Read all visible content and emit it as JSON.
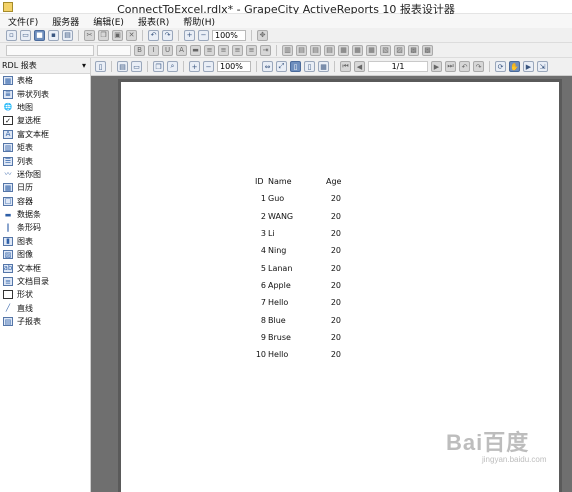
{
  "window": {
    "title": "ConnectToExcel.rdlx* - GrapeCity ActiveReports 10 报表设计器"
  },
  "menu": {
    "items": [
      "文件(F)",
      "服务器",
      "编辑(E)",
      "报表(R)",
      "帮助(H)"
    ]
  },
  "toolbar": {
    "zoom": "100%"
  },
  "viewer_toolbar": {
    "zoom": "100%",
    "page_indicator": "1/1"
  },
  "sidebar": {
    "header": "RDL 报表",
    "items": [
      {
        "label": "表格",
        "icon": "table-icon"
      },
      {
        "label": "带状列表",
        "icon": "banded-list-icon"
      },
      {
        "label": "地图",
        "icon": "map-icon"
      },
      {
        "label": "复选框",
        "icon": "checkbox-icon"
      },
      {
        "label": "富文本框",
        "icon": "rich-textbox-icon"
      },
      {
        "label": "矩表",
        "icon": "matrix-icon"
      },
      {
        "label": "列表",
        "icon": "list-icon"
      },
      {
        "label": "迷你图",
        "icon": "sparkline-icon"
      },
      {
        "label": "日历",
        "icon": "calendar-icon"
      },
      {
        "label": "容器",
        "icon": "container-icon"
      },
      {
        "label": "数据条",
        "icon": "databar-icon"
      },
      {
        "label": "条形码",
        "icon": "barcode-icon"
      },
      {
        "label": "图表",
        "icon": "chart-icon"
      },
      {
        "label": "图像",
        "icon": "image-icon"
      },
      {
        "label": "文本框",
        "icon": "textbox-icon"
      },
      {
        "label": "文档目录",
        "icon": "toc-icon"
      },
      {
        "label": "形状",
        "icon": "shape-icon"
      },
      {
        "label": "直线",
        "icon": "line-icon"
      },
      {
        "label": "子报表",
        "icon": "subreport-icon"
      }
    ]
  },
  "report": {
    "headers": [
      "ID",
      "Name",
      "Age"
    ],
    "rows": [
      [
        "1",
        "Guo",
        "20"
      ],
      [
        "2",
        "WANG",
        "20"
      ],
      [
        "3",
        "Li",
        "20"
      ],
      [
        "4",
        "Ning",
        "20"
      ],
      [
        "5",
        "Lanan",
        "20"
      ],
      [
        "6",
        "Apple",
        "20"
      ],
      [
        "7",
        "Hello",
        "20"
      ],
      [
        "8",
        "Blue",
        "20"
      ],
      [
        "9",
        "Bruse",
        "20"
      ],
      [
        "10",
        "Hello",
        "20"
      ]
    ]
  },
  "watermark": {
    "logo": "Bai百度",
    "url": "jingyan.baidu.com"
  }
}
